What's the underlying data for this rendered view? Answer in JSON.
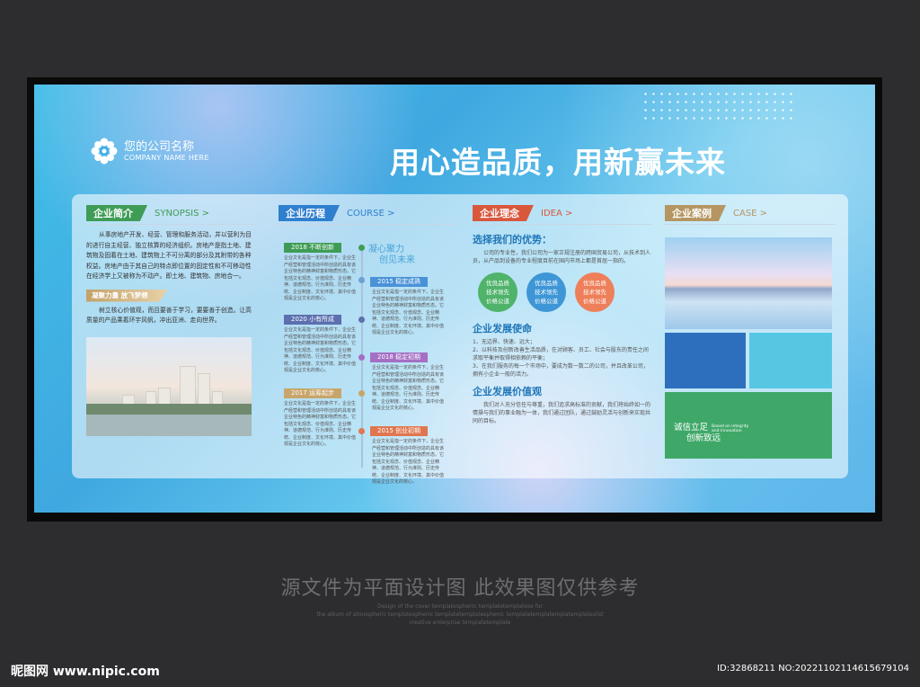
{
  "brand": {
    "name_cn": "您的公司名称",
    "name_en": "COMPANY NAME HERE"
  },
  "slogan": "用心造品质，用新赢未来",
  "colors": {
    "green_tag": "#3e9c56",
    "blue_tag": "#2f7fcf",
    "orange_tag": "#d9573b",
    "gold_tag": "#b59662",
    "circle_green": "#4fb36a",
    "circle_blue": "#3e96d6",
    "circle_orange": "#ee7f5a"
  },
  "synopsis": {
    "tag": "企业简介",
    "tag_en": "SYNOPSIS >",
    "body": "从事房地产开发、经营、管理和服务活动，并以营利为目的进行自主经营、独立核算的经济组织。房地产是指土地、建筑物及固着在土地、建筑物上不可分离的部分及其附带的各种权益。房地产由于其自己的特点即位置的固定性和不可移动性在经济学上又被称为不动产。即土地、建筑物、房地合一。",
    "subtag": "凝聚力量 放飞梦想",
    "sub_body": "树立核心价值观，而且要善于学习，要要善于创造。让高质量的产品乘着环宇风帆，冲出亚洲、走向世界。"
  },
  "course": {
    "tag": "企业历程",
    "tag_en": "COURSE >",
    "top_line1": "凝心聚力",
    "top_line2": "创见未来",
    "item_text": "企业文化是指一定的条件下，企业生产经营和管理活动中所创造的具有该企业特色的精神财富和物质形态。它包括文化观念、价值观念、企业精神、道德规范、行为准则、历史传统、企业制度、文化环境、其中价值观是企业文化的核心。",
    "milestones": [
      {
        "year": "2018 不断创新"
      },
      {
        "year": "2015 稳定成熟"
      },
      {
        "year": "2020 小有所成"
      },
      {
        "year": "2018 稳定初期"
      },
      {
        "year": "2017 运筹起步"
      },
      {
        "year": "2015 创业初期"
      }
    ]
  },
  "idea": {
    "tag": "企业理念",
    "tag_en": "IDEA >",
    "adv_title": "选择我们的优势：",
    "adv_body": "公司的专业性，我们公司为一家正规注册的跨国贸易公司，从技术到人员，从产品到设备的专业程度目前在国内市场上都是首屈一指的。",
    "circles": [
      {
        "l1": "优良品质",
        "l2": "技术领先",
        "l3": "价格公道"
      },
      {
        "l1": "优良品质",
        "l2": "技术领先",
        "l3": "价格公道"
      },
      {
        "l1": "优良品质",
        "l2": "技术领先",
        "l3": "价格公道"
      }
    ],
    "mission_title": "企业发展使命",
    "mission_items": [
      "1、无边界、快速、远大；",
      "2、以科技及创新改善生活品质，在对顾客、员工、社会与股东的责任之间求取平衡并取得相依赖的平衡；",
      "3、在我们服务的每一个市场中，要成为数一数二的公司，并且改革公司，拥有小企业一般的活力。"
    ],
    "value_title": "企业发展价值观",
    "value_body": "我们对人充分信任与尊重，我们追求高标准的贡献，我们将始终如一的情操与我们的事业融为一体，我们通过团队，通过鼓励灵活与创新来实现共同的目标。"
  },
  "case": {
    "tag": "企业案例",
    "tag_en": "CASE >",
    "motto_l1": "诚信立足",
    "motto_l2": "创新致远",
    "motto_en": "Based on integrity and innovation"
  },
  "captions": {
    "cn": "源文件为平面设计图 此效果图仅供参考",
    "en_l1": "Design of the cover templatesphenic templatetemplatese for",
    "en_l2": "the album of atmospheric templatesphenic templatetemplatesphenic templatetemplatemplatemplateslist",
    "en_l3": "creative enterprise templatetemplate",
    "site": "昵图网 www.nipic.com",
    "id": "ID:32868211 NO:20221102114615679104"
  }
}
